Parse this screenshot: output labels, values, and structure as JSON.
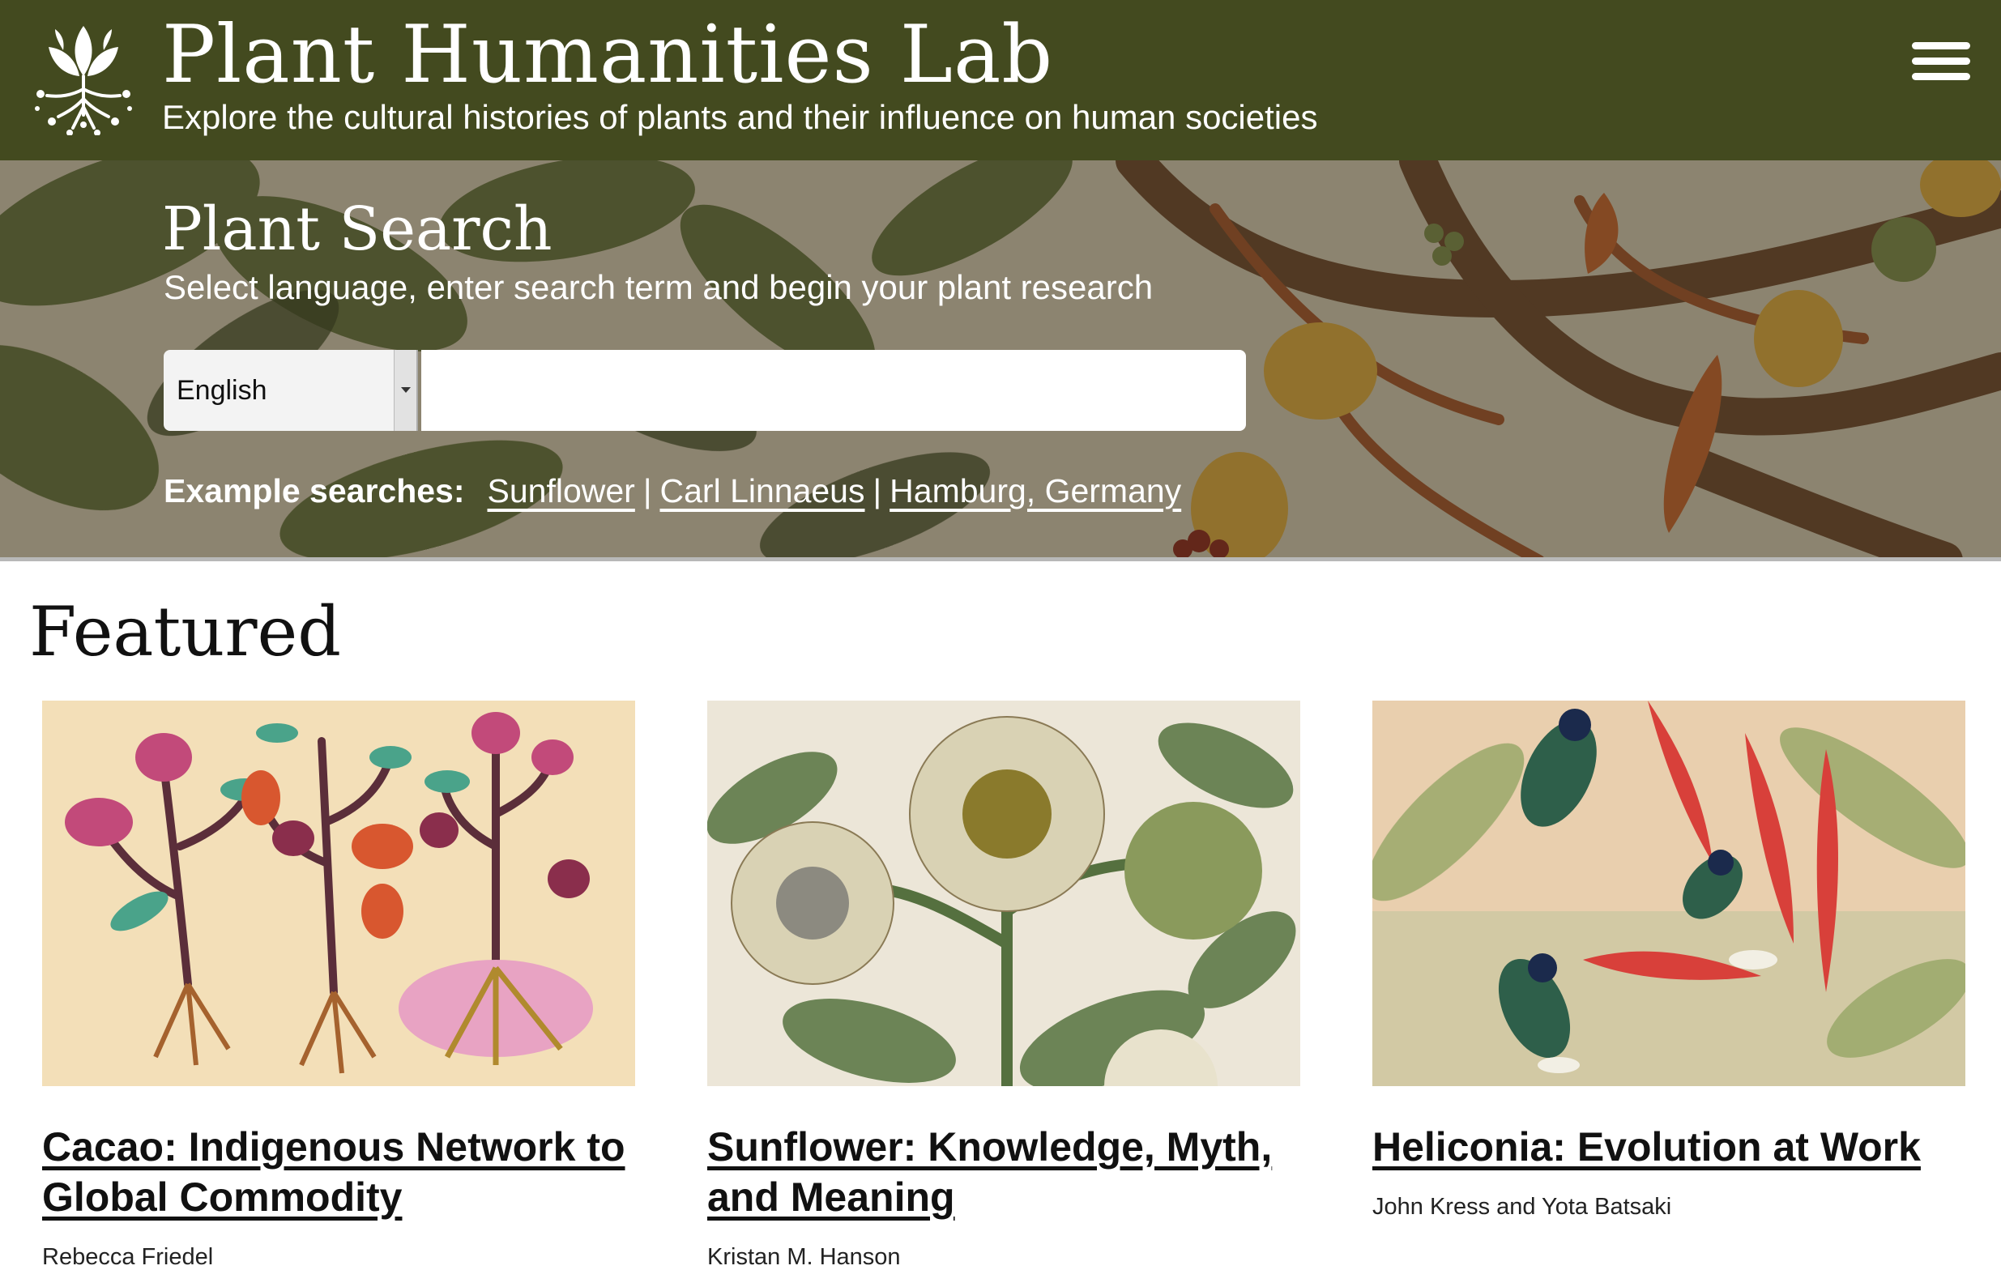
{
  "header": {
    "title": "Plant Humanities Lab",
    "tagline": "Explore the cultural histories of plants and their influence on human societies"
  },
  "search": {
    "title": "Plant Search",
    "subtitle": "Select language, enter search term and begin your plant research",
    "language": "English",
    "input_value": "",
    "examples_label": "Example searches:",
    "examples": [
      "Sunflower",
      "Carl Linnaeus",
      "Hamburg, Germany"
    ],
    "separator": "|"
  },
  "featured": {
    "heading": "Featured",
    "cards": [
      {
        "title": "Cacao: Indigenous Network to Global Commodity",
        "author": "Rebecca Friedel"
      },
      {
        "title": "Sunflower: Knowledge, Myth, and Meaning",
        "author": "Kristan M. Hanson"
      },
      {
        "title": "Heliconia: Evolution at Work",
        "author": "John Kress and Yota Batsaki"
      }
    ]
  },
  "colors": {
    "header_bg": "#434a1f",
    "text_light": "#ffffff",
    "text_dark": "#111111"
  },
  "icons": [
    "plant-roots-logo-icon",
    "hamburger-menu-icon",
    "dropdown-arrow-icon"
  ]
}
